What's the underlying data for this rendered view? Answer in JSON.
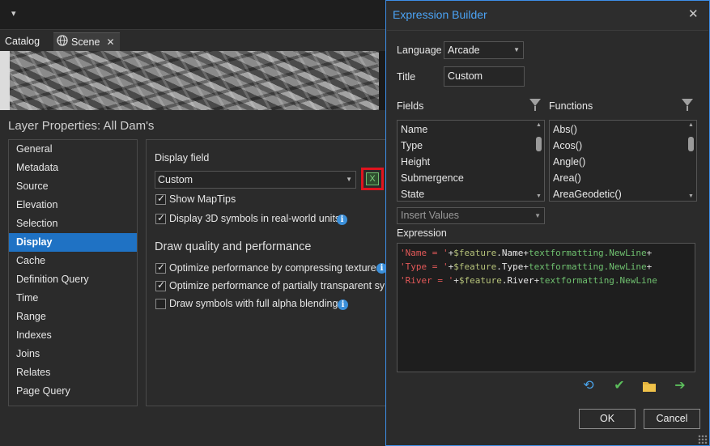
{
  "qat": {
    "symbol": "▾"
  },
  "doc_tabs": {
    "catalog": "Catalog",
    "scene": "Scene",
    "close": "✕"
  },
  "layer_properties": {
    "title": "Layer Properties: All Dam's",
    "nav": [
      "General",
      "Metadata",
      "Source",
      "Elevation",
      "Selection",
      "Display",
      "Cache",
      "Definition Query",
      "Time",
      "Range",
      "Indexes",
      "Joins",
      "Relates",
      "Page Query"
    ],
    "selected_nav": "Display",
    "display_field_label": "Display field",
    "display_field_value": "Custom",
    "expression_button_icon": "X",
    "checkboxes": {
      "show_maptips": {
        "label": "Show MapTips",
        "checked": true
      },
      "display_3d": {
        "label": "Display 3D symbols in real-world units",
        "checked": true
      },
      "optimize_textures": {
        "label": "Optimize performance by compressing textures",
        "checked": true
      },
      "optimize_transparent": {
        "label": "Optimize performance of partially transparent sym",
        "checked": true
      },
      "alpha_blending": {
        "label": "Draw symbols with full alpha blending",
        "checked": false
      }
    },
    "section_heading": "Draw quality and performance",
    "info_glyph": "i"
  },
  "expression_builder": {
    "title": "Expression Builder",
    "close": "✕",
    "language_label": "Language",
    "language_value": "Arcade",
    "title_label": "Title",
    "title_value": "Custom",
    "fields_label": "Fields",
    "functions_label": "Functions",
    "fields": [
      "Name",
      "Type",
      "Height",
      "Submergence",
      "State"
    ],
    "functions": [
      "Abs()",
      "Acos()",
      "Angle()",
      "Area()",
      "AreaGeodetic()"
    ],
    "insert_values_placeholder": "Insert Values",
    "expression_label": "Expression",
    "expression_lines": [
      {
        "str": "'Name = '",
        "plus1": "+",
        "feat": "$feature",
        "prop": ".Name",
        "plus2": "+",
        "fn": "textformatting.NewLine",
        "plus3": "+"
      },
      {
        "str": "'Type = '",
        "plus1": "+",
        "feat": "$feature",
        "prop": ".Type",
        "plus2": "+",
        "fn": "textformatting.NewLine",
        "plus3": "+"
      },
      {
        "str": "'River = '",
        "plus1": "+",
        "feat": "$feature",
        "prop": ".River",
        "plus2": "+",
        "fn": "textformatting.NewLine",
        "plus3": ""
      }
    ],
    "toolbar": {
      "undo": "⟲",
      "verify": "✔",
      "open": "folder",
      "export": "➔"
    },
    "ok_label": "OK",
    "cancel_label": "Cancel"
  },
  "colors": {
    "accent": "#1f72c4",
    "dialog_border": "#3d8ee8",
    "highlight_red": "#e0141e",
    "title_blue": "#4ba3f5"
  }
}
